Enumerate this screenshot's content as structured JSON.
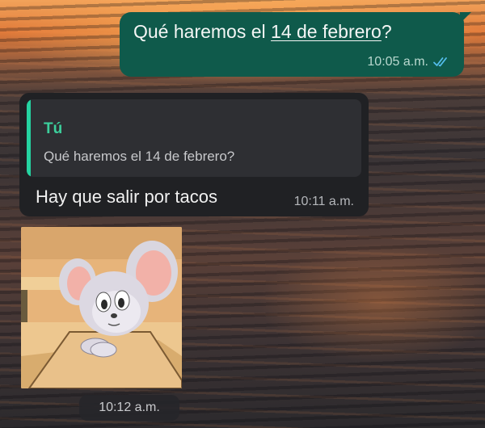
{
  "messages": {
    "outgoing": {
      "text_before": "Qué haremos el ",
      "text_link": "14 de febrero",
      "text_after": "?",
      "time": "10:05 a.m.",
      "status_icon": "double-check-read-icon",
      "bubble_color": "#0f5a4b"
    },
    "reply": {
      "quoted_author": "Tú",
      "quoted_text": "Qué haremos el 14 de febrero?",
      "text": "Hay que salir por tacos",
      "time": "10:11 a.m.",
      "accent_color": "#25d3a1"
    },
    "sticker": {
      "icon": "mouse-cartoon-sticker",
      "time": "10:12 a.m."
    }
  }
}
